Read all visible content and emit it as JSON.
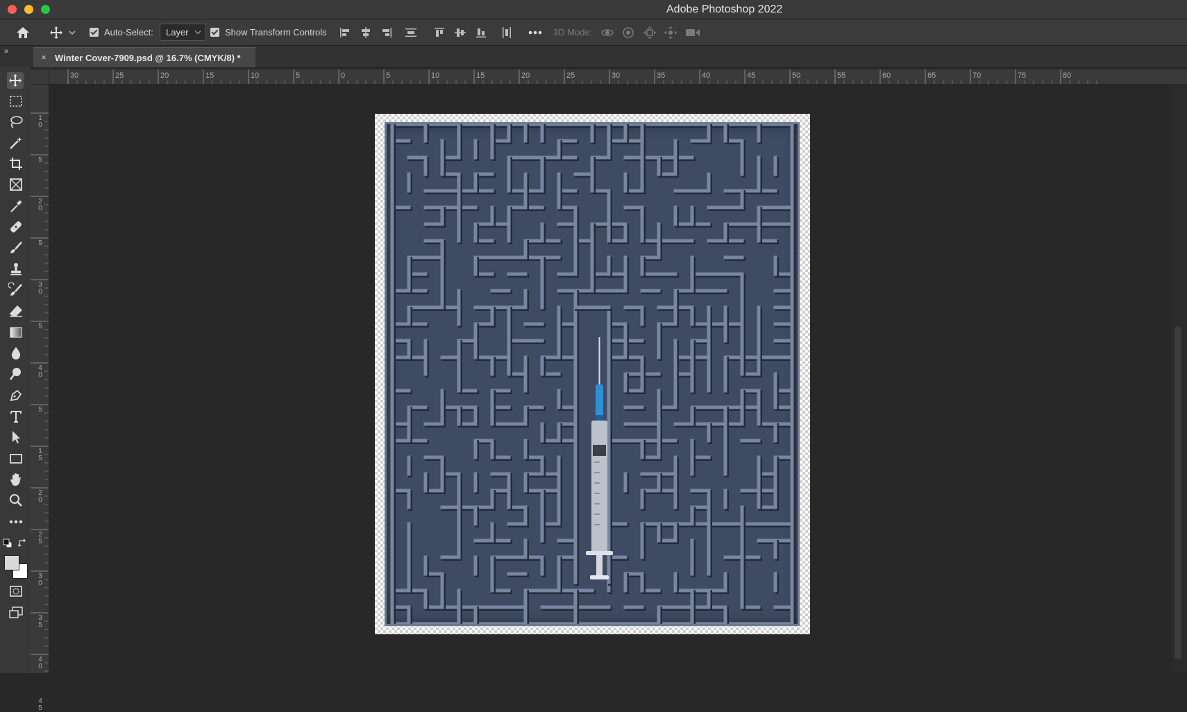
{
  "window": {
    "title": "Adobe Photoshop 2022"
  },
  "options_bar": {
    "auto_select_label": "Auto-Select:",
    "auto_select_checked": true,
    "auto_select_target": "Layer",
    "show_transform_label": "Show Transform Controls",
    "show_transform_checked": true,
    "mode_3d_label": "3D Mode:"
  },
  "document_tab": {
    "close_glyph": "×",
    "title": "Winter Cover-7909.psd @ 16.7% (CMYK/8) *"
  },
  "panel_collapse_glyph": "»",
  "rulers": {
    "horizontal_labels": [
      "30",
      "25",
      "20",
      "15",
      "10",
      "5",
      "0",
      "5",
      "10",
      "15",
      "20",
      "25",
      "30",
      "35",
      "40",
      "45",
      "50",
      "55",
      "60",
      "65",
      "70",
      "75",
      "80"
    ],
    "vertical_labels": [
      "1\n0",
      "5",
      "2\n0",
      "5",
      "3\n0",
      "5",
      "4\n0",
      "5",
      "1\n5",
      "2\n0",
      "2\n5",
      "3\n0",
      "3\n5",
      "4\n0",
      "4\n5"
    ]
  },
  "tools": [
    "move-tool-icon",
    "rectangular-marquee-icon",
    "lasso-icon",
    "magic-wand-icon",
    "crop-icon",
    "frame-icon",
    "eyedropper-icon",
    "healing-brush-icon",
    "brush-icon",
    "clone-stamp-icon",
    "history-brush-icon",
    "eraser-icon",
    "gradient-icon",
    "blur-icon",
    "dodge-icon",
    "pen-icon",
    "type-icon",
    "path-selection-icon",
    "rectangle-icon",
    "hand-icon",
    "zoom-icon",
    "more-tools-icon"
  ],
  "colors": {
    "foreground": "#d9d9d9",
    "background": "#ffffff",
    "maze": "#3e4b62",
    "needle": "#2e8fd6"
  }
}
